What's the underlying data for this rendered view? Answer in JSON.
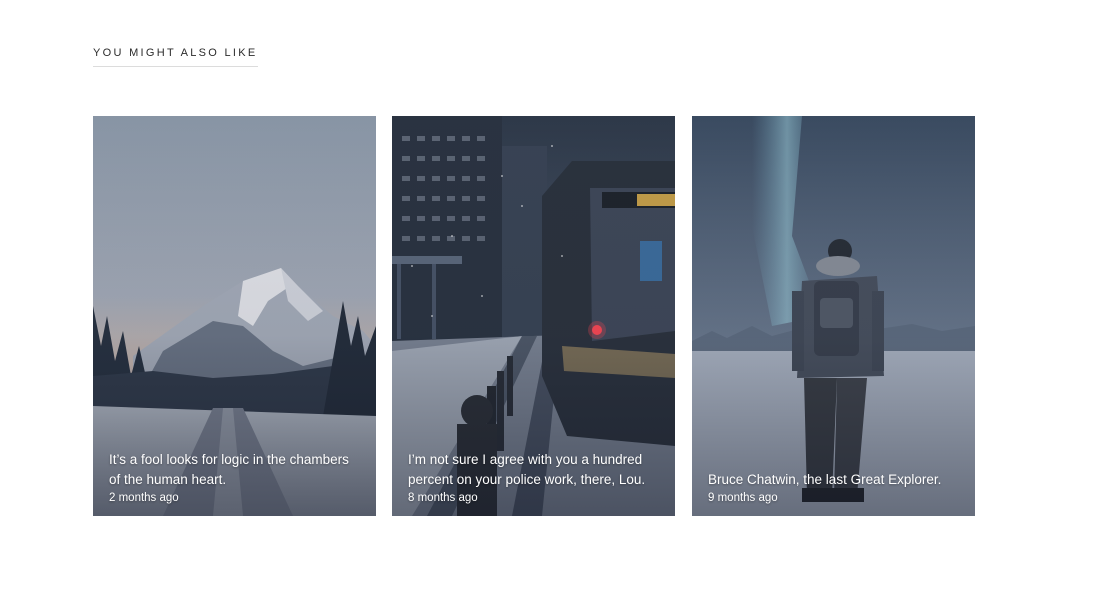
{
  "section": {
    "title": "YOU MIGHT ALSO LIKE"
  },
  "posts": [
    {
      "title": "It’s a fool looks for logic in the chambers of the human heart.",
      "date": "2 months ago",
      "image": "snowy-mountain-road"
    },
    {
      "title": "I’m not sure I agree with you a hundred percent on your police work, there, Lou.",
      "date": "8 months ago",
      "image": "winter-city-tram"
    },
    {
      "title": "Bruce Chatwin, the last Great Explorer.",
      "date": "9 months ago",
      "image": "aurora-explorer"
    }
  ],
  "colors": {
    "title_text": "#2b2b2b",
    "caption_text": "#ffffff",
    "underline": "#dcdcdc"
  }
}
